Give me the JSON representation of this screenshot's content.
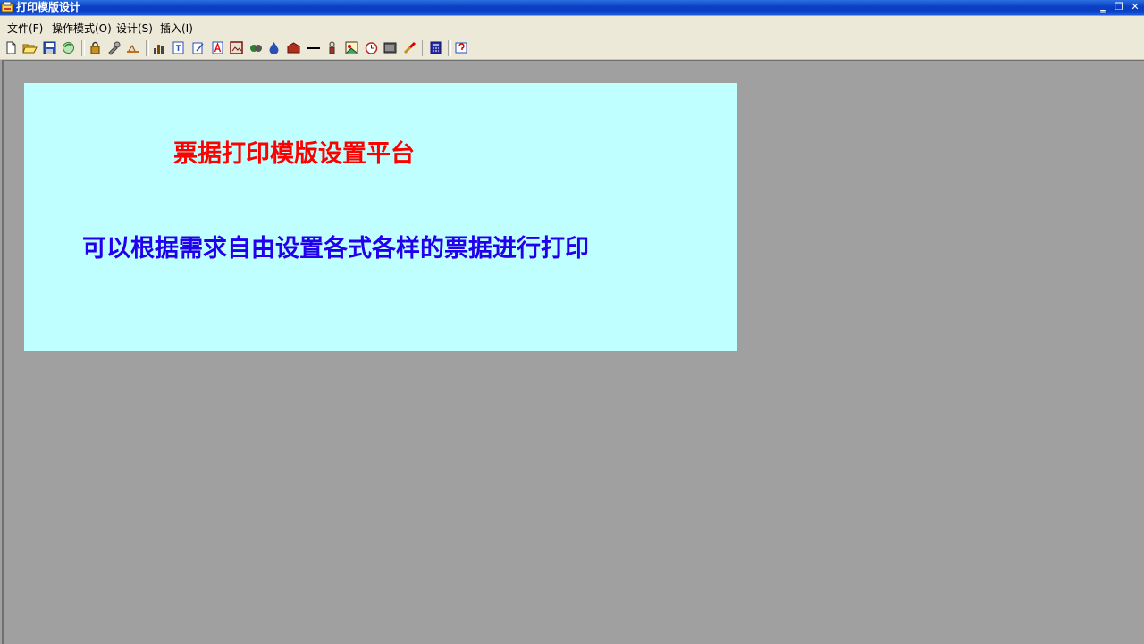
{
  "window": {
    "title": "打印模版设计",
    "controls": [
      "minimize",
      "restore",
      "close"
    ]
  },
  "menu": {
    "items": [
      {
        "label": "文件(F)"
      },
      {
        "label": "操作模式(O)"
      },
      {
        "label": "设计(S)"
      },
      {
        "label": "插入(I)"
      }
    ]
  },
  "toolbar": {
    "buttons": [
      "new-icon",
      "open-folder-icon",
      "save-icon",
      "refresh-icon",
      "lock-icon",
      "tool-icon",
      "hand-icon",
      "chart-icon",
      "text-icon",
      "edit-icon",
      "font-icon",
      "image-icon",
      "group-icon",
      "drop-icon",
      "box-icon",
      "line-icon",
      "person-icon",
      "picture-icon",
      "clock-icon",
      "barcode-icon",
      "brush-icon",
      "calculator-icon",
      "help-icon"
    ]
  },
  "canvas": {
    "background": "#c0ffff",
    "heading": "票据打印模版设置平台",
    "heading_color": "#ff0000",
    "subheading": "可以根据需求自由设置各式各样的票据进行打印",
    "subheading_color": "#2200ee"
  },
  "colors": {
    "workspace": "#a0a0a0",
    "titlebar": "#0a3fc4",
    "menubar": "#ece9d8"
  }
}
